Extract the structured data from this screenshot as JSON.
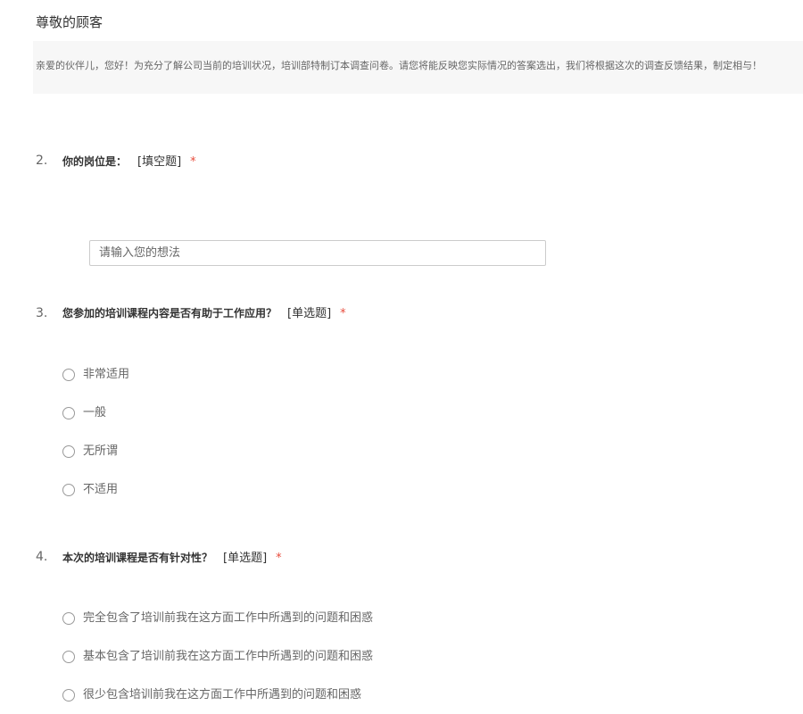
{
  "header": {
    "greeting": "尊敬的顾客",
    "intro": "亲爱的伙伴儿，您好！为充分了解公司当前的培训状况，培训部特制订本调查问卷。请您将能反映您实际情况的答案选出，我们将根据这次的调查反馈结果，制定相与！"
  },
  "questions": [
    {
      "number": "2.",
      "title": "你的岗位是：",
      "type": "[填空题]",
      "required_mark": "*",
      "input_placeholder": "请输入您的想法",
      "input_value": ""
    },
    {
      "number": "3.",
      "title": "您参加的培训课程内容是否有助于工作应用？",
      "type": "[单选题]",
      "required_mark": "*",
      "options": [
        "非常适用",
        "一般",
        "无所谓",
        "不适用"
      ]
    },
    {
      "number": "4.",
      "title": "本次的培训课程是否有针对性？",
      "type": "[单选题]",
      "required_mark": "*",
      "options": [
        "完全包含了培训前我在这方面工作中所遇到的问题和困惑",
        "基本包含了培训前我在这方面工作中所遇到的问题和困惑",
        "很少包含培训前我在这方面工作中所遇到的问题和困惑"
      ]
    }
  ],
  "colors": {
    "required": "#e84c3d",
    "intro_background": "#f7f7f7",
    "radio_border": "#999999"
  }
}
